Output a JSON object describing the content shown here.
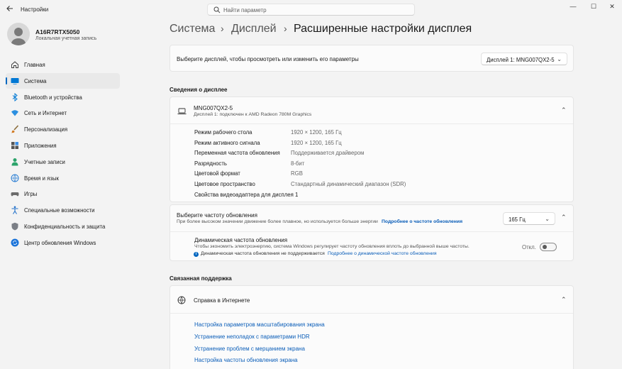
{
  "window": {
    "title": "Настройки",
    "search_placeholder": "Найти параметр",
    "minimize": "—",
    "maximize": "☐",
    "close": "✕"
  },
  "profile": {
    "name": "A16R7RTX5050",
    "account": "Локальная учетная запись"
  },
  "sidebar": {
    "items": [
      {
        "label": "Главная",
        "icon": "home-icon"
      },
      {
        "label": "Система",
        "icon": "system-icon",
        "active": true
      },
      {
        "label": "Bluetooth и устройства",
        "icon": "bluetooth-icon"
      },
      {
        "label": "Сеть и Интернет",
        "icon": "wifi-icon"
      },
      {
        "label": "Персонализация",
        "icon": "brush-icon"
      },
      {
        "label": "Приложения",
        "icon": "apps-icon"
      },
      {
        "label": "Учетные записи",
        "icon": "accounts-icon"
      },
      {
        "label": "Время и язык",
        "icon": "globe-clock-icon"
      },
      {
        "label": "Игры",
        "icon": "gamepad-icon"
      },
      {
        "label": "Специальные возможности",
        "icon": "accessibility-icon"
      },
      {
        "label": "Конфиденциальность и защита",
        "icon": "shield-icon"
      },
      {
        "label": "Центр обновления Windows",
        "icon": "update-icon"
      }
    ]
  },
  "breadcrumb": {
    "items": [
      "Система",
      "Дисплей",
      "Расширенные настройки дисплея"
    ],
    "separator": "›"
  },
  "display_select": {
    "label": "Выберите дисплей, чтобы просмотреть или изменить его параметры",
    "value": "Дисплей 1: MNG007QX2-5"
  },
  "display_info": {
    "heading": "Сведения о дисплее",
    "name": "MNG007QX2-5",
    "connection": "Дисплей 1: подключен к AMD Radeon 780M Graphics",
    "rows": [
      {
        "key": "Режим рабочего стола",
        "value": "1920 × 1200, 165 Гц"
      },
      {
        "key": "Режим активного сигнала",
        "value": "1920 × 1200, 165 Гц"
      },
      {
        "key": "Переменная частота обновления",
        "value": "Поддерживается драйвером"
      },
      {
        "key": "Разрядность",
        "value": "8-бит"
      },
      {
        "key": "Цветовой формат",
        "value": "RGB"
      },
      {
        "key": "Цветовое пространство",
        "value": "Стандартный динамический диапазон (SDR)"
      }
    ],
    "adapter_link": "Свойства видеоадаптера для дисплея 1"
  },
  "refresh_rate": {
    "title": "Выберите частоту обновления",
    "description": "При более высоком значении движение более плавное, но используется больше энергии",
    "link": "Подробнее о частоте обновления",
    "value": "165 Гц",
    "dynamic_title": "Динамическая частота обновления",
    "dynamic_description": "Чтобы экономить электроэнергию, система Windows регулирует частоту обновления вплоть до выбранной выше частоты.",
    "dynamic_note": "Динамическая частота обновления не поддерживается",
    "dynamic_link": "Подробнее о динамической частоте обновления",
    "toggle_state": "Откл."
  },
  "related": {
    "heading": "Связанная поддержка",
    "help_title": "Справка в Интернете",
    "links": [
      "Настройка параметров масштабирования экрана",
      "Устранение неполадок с параметрами HDR",
      "Устранение проблем с мерцанием экрана",
      "Настройка частоты обновления экрана"
    ]
  },
  "colors": {
    "accent": "#0067c0",
    "link": "#0a5db8",
    "background": "#f3f3f3",
    "card": "#fbfbfb"
  }
}
